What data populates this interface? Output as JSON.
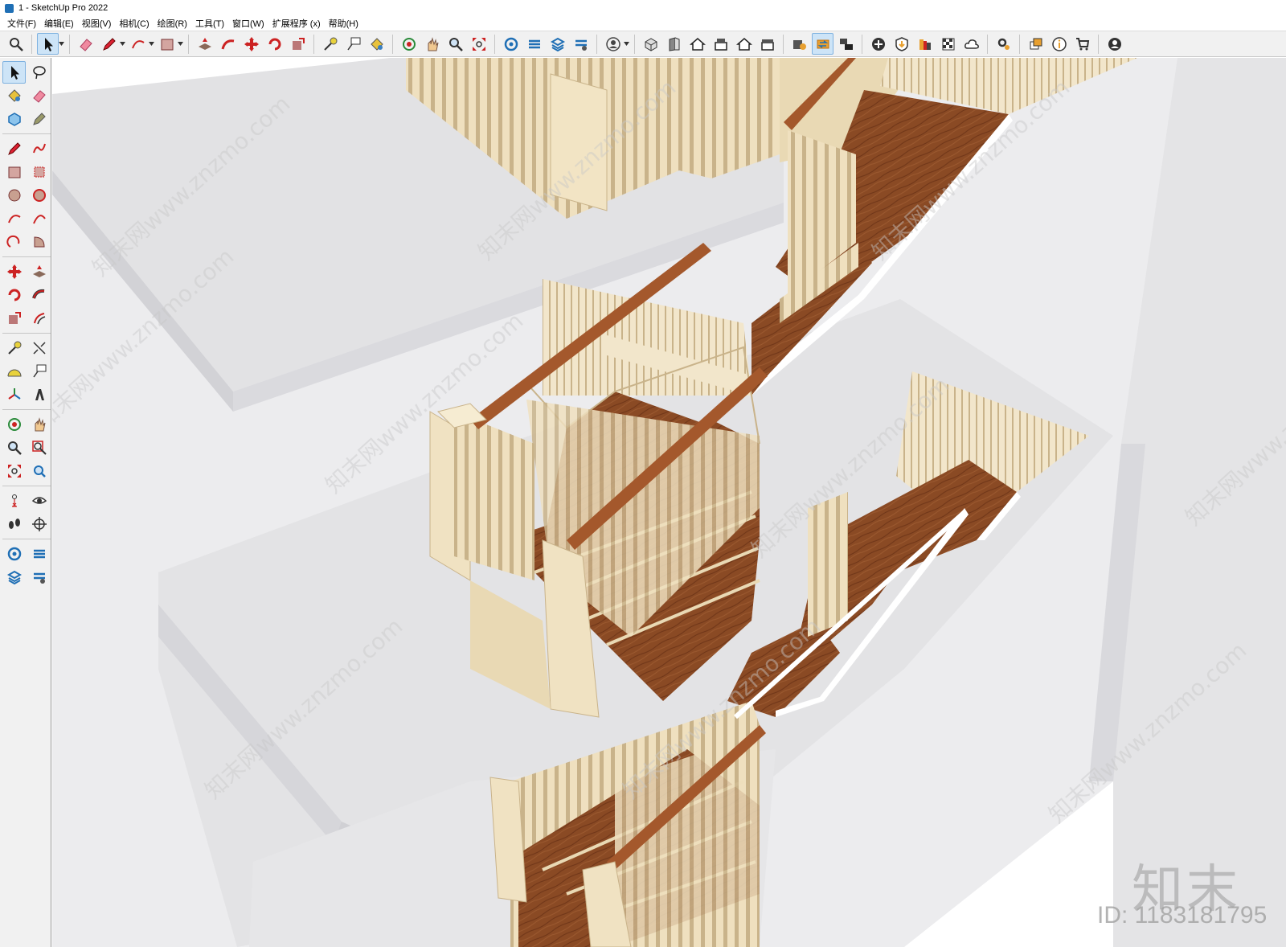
{
  "window": {
    "title": "1 - SketchUp Pro 2022"
  },
  "menu": [
    {
      "label": "文件(F)"
    },
    {
      "label": "编辑(E)"
    },
    {
      "label": "视图(V)"
    },
    {
      "label": "相机(C)"
    },
    {
      "label": "绘图(R)"
    },
    {
      "label": "工具(T)"
    },
    {
      "label": "窗口(W)"
    },
    {
      "label": "扩展程序 (x)"
    },
    {
      "label": "帮助(H)"
    }
  ],
  "toolbar": {
    "active_tool": "select",
    "icons": [
      "search-icon",
      "select-icon",
      "eraser-icon",
      "pencil-icon",
      "arc-icon",
      "rectangle-icon",
      "push-pull-icon",
      "follow-me-icon",
      "move-icon",
      "rotate-icon",
      "scale-icon",
      "tape-measure-icon",
      "text-icon",
      "paint-bucket-icon",
      "orbit-icon",
      "pan-icon",
      "zoom-icon",
      "zoom-extents-icon",
      "warehouse-icon",
      "extension-warehouse-icon",
      "layout-icon",
      "styles-icon",
      "account-icon",
      "iso-view-icon",
      "front-view-icon",
      "home-view-icon",
      "top-view-icon",
      "back-view-icon",
      "right-view-icon",
      "solid-tools-icon",
      "section-icon",
      "scenes-icon",
      "add-location-icon",
      "shadow-icon",
      "materials-icon",
      "fog-icon",
      "cloud-icon",
      "settings-icon",
      "outliner-icon",
      "info-icon",
      "cart-icon",
      "profile-icon"
    ]
  },
  "watermark": {
    "brand": "知末",
    "id_text": "ID: 1183181795",
    "diagonal_text": "知末网www.znzmo.com"
  },
  "colors": {
    "accent_select": "#cde4f7",
    "wood": "#8a4a24",
    "railing": "#f0e2c2",
    "wall": "#e6e6e8",
    "wall_shade": "#d6d6da"
  }
}
